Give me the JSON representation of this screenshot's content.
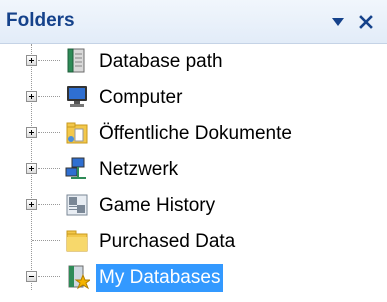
{
  "panel": {
    "title": "Folders",
    "dropdown_icon": "chevron-down-icon",
    "close_icon": "close-icon"
  },
  "tree": {
    "items": [
      {
        "label": "Database path",
        "icon": "database-path-icon",
        "expandable": true,
        "expanded": false
      },
      {
        "label": "Computer",
        "icon": "computer-icon",
        "expandable": true,
        "expanded": false
      },
      {
        "label": "Öffentliche Dokumente",
        "icon": "shared-folder-icon",
        "expandable": true,
        "expanded": false
      },
      {
        "label": "Netzwerk",
        "icon": "network-icon",
        "expandable": true,
        "expanded": false
      },
      {
        "label": "Game History",
        "icon": "game-history-icon",
        "expandable": true,
        "expanded": false
      },
      {
        "label": "Purchased Data",
        "icon": "folder-icon",
        "expandable": false,
        "expanded": false
      },
      {
        "label": "My Databases",
        "icon": "my-databases-icon",
        "expandable": true,
        "expanded": true,
        "selected": true
      }
    ]
  },
  "colors": {
    "header_text": "#15428b",
    "selection": "#3399ff"
  }
}
